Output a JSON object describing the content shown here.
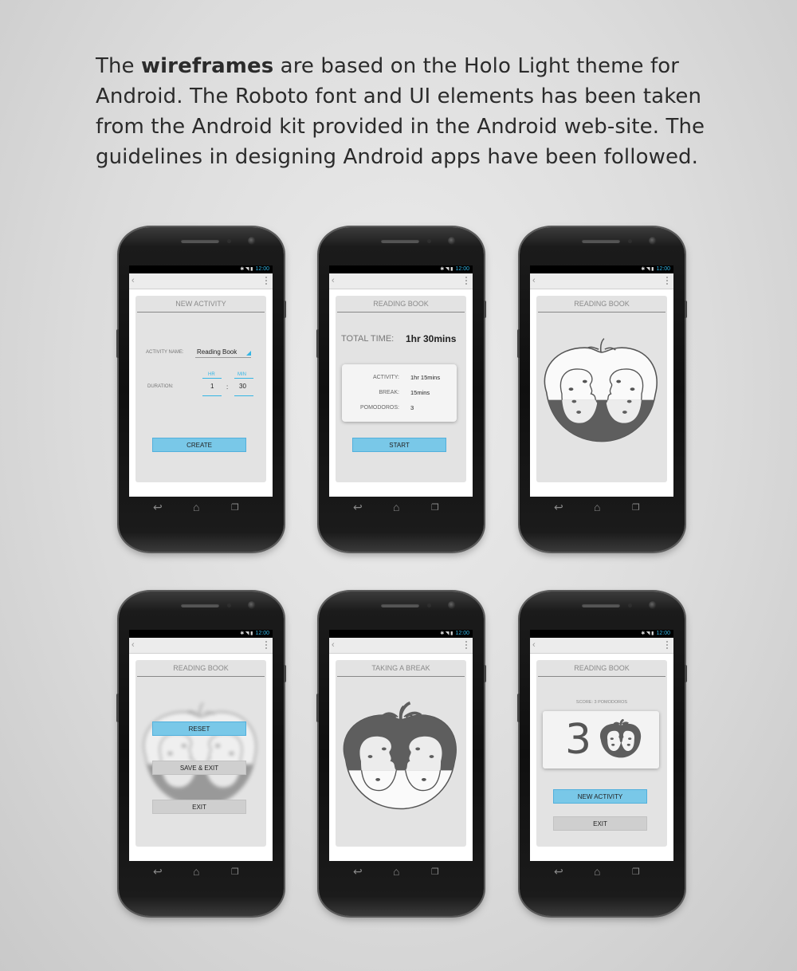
{
  "intro": {
    "prefix": "The ",
    "bold": "wireframes",
    "rest": " are based on the Holo Light theme for Android. The Roboto font and UI elements has been taken from the Android kit provided in the Android web-site. The guidelines in designing Android apps have been followed."
  },
  "status_time": "12:00",
  "screens": {
    "new_activity": {
      "title": "NEW ACTIVITY",
      "activity_name_label": "ACTIVITY NAME:",
      "activity_name_value": "Reading Book",
      "duration_label": "DURATION:",
      "hr_label": "HR",
      "min_label": "MIN",
      "hours": "1",
      "separator": ":",
      "minutes": "30",
      "create_button": "CREATE"
    },
    "summary": {
      "title": "READING BOOK",
      "total_label": "TOTAL TIME:",
      "total_value": "1hr 30mins",
      "activity_label": "ACTIVITY:",
      "activity_value": "1hr 15mins",
      "break_label": "BREAK:",
      "break_value": "15mins",
      "pomodoros_label": "POMODOROS:",
      "pomodoros_value": "3",
      "start_button": "START"
    },
    "timer": {
      "title": "READING BOOK"
    },
    "paused": {
      "title": "READING BOOK",
      "reset_button": "RESET",
      "save_exit_button": "SAVE & EXIT",
      "exit_button": "EXIT"
    },
    "break": {
      "title": "TAKING A BREAK"
    },
    "score": {
      "title": "READING BOOK",
      "score_caption": "SCORE: 3 POMODOROS",
      "score_digit": "3",
      "new_activity_button": "NEW ACTIVITY",
      "exit_button": "EXIT"
    }
  },
  "colors": {
    "holo_blue": "#33b5e5",
    "button_blue": "#79c8e8",
    "tomato_fill": "#5e5e5e"
  }
}
